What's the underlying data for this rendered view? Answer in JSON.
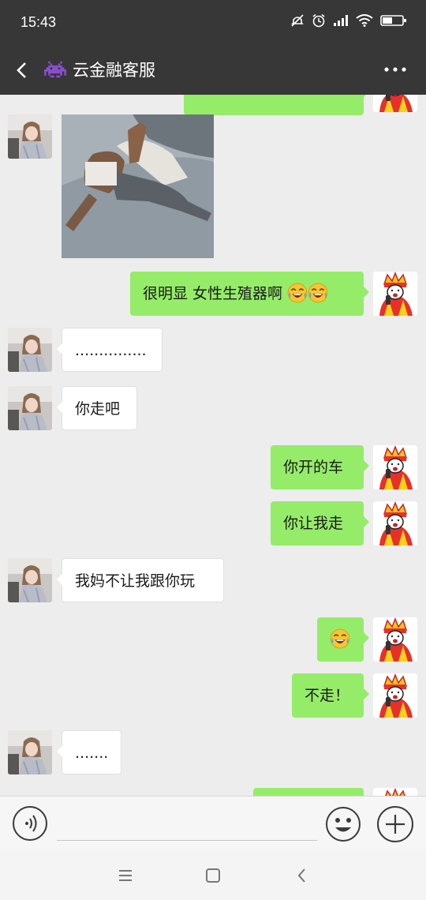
{
  "status_bar": {
    "time": "15:43",
    "icons": [
      "mute-icon",
      "alarm-icon",
      "signal-icon",
      "wifi-icon",
      "battery-icon"
    ]
  },
  "header": {
    "title": "云金融客服",
    "title_emoji": "space-invader-icon",
    "back_icon": "back-arrow-icon",
    "more_icon": "more-dots-icon"
  },
  "colors": {
    "header_bg": "#373737",
    "chat_bg": "#ededed",
    "outgoing_bubble": "#95ec69",
    "incoming_bubble": "#ffffff"
  },
  "messages": [
    {
      "side": "outgoing",
      "type": "text",
      "text": "",
      "partially_visible": true
    },
    {
      "side": "incoming",
      "type": "image",
      "image": "photo-person-on-bed"
    },
    {
      "side": "outgoing",
      "type": "text",
      "text": "很明显 女性生殖器啊",
      "emojis": [
        "laughing-crying-emoji",
        "laughing-crying-emoji"
      ]
    },
    {
      "side": "incoming",
      "type": "text",
      "text": "..............."
    },
    {
      "side": "incoming",
      "type": "text",
      "text": "你走吧"
    },
    {
      "side": "outgoing",
      "type": "text",
      "text": "你开的车"
    },
    {
      "side": "outgoing",
      "type": "text",
      "text": "你让我走"
    },
    {
      "side": "incoming",
      "type": "text",
      "text": "我妈不让我跟你玩"
    },
    {
      "side": "outgoing",
      "type": "emoji",
      "text": "",
      "emojis": [
        "laughing-crying-emoji"
      ]
    },
    {
      "side": "outgoing",
      "type": "text",
      "text": "不走！"
    },
    {
      "side": "incoming",
      "type": "text",
      "text": "......."
    },
    {
      "side": "outgoing",
      "type": "text",
      "text": "",
      "partially_visible": true
    }
  ],
  "input_bar": {
    "voice_icon": "voice-input-icon",
    "input_value": "",
    "emoji_icon": "emoji-smile-icon",
    "plus_icon": "plus-icon"
  },
  "system_nav": {
    "icons": [
      "menu-icon",
      "home-square-icon",
      "back-chevron-icon"
    ]
  }
}
